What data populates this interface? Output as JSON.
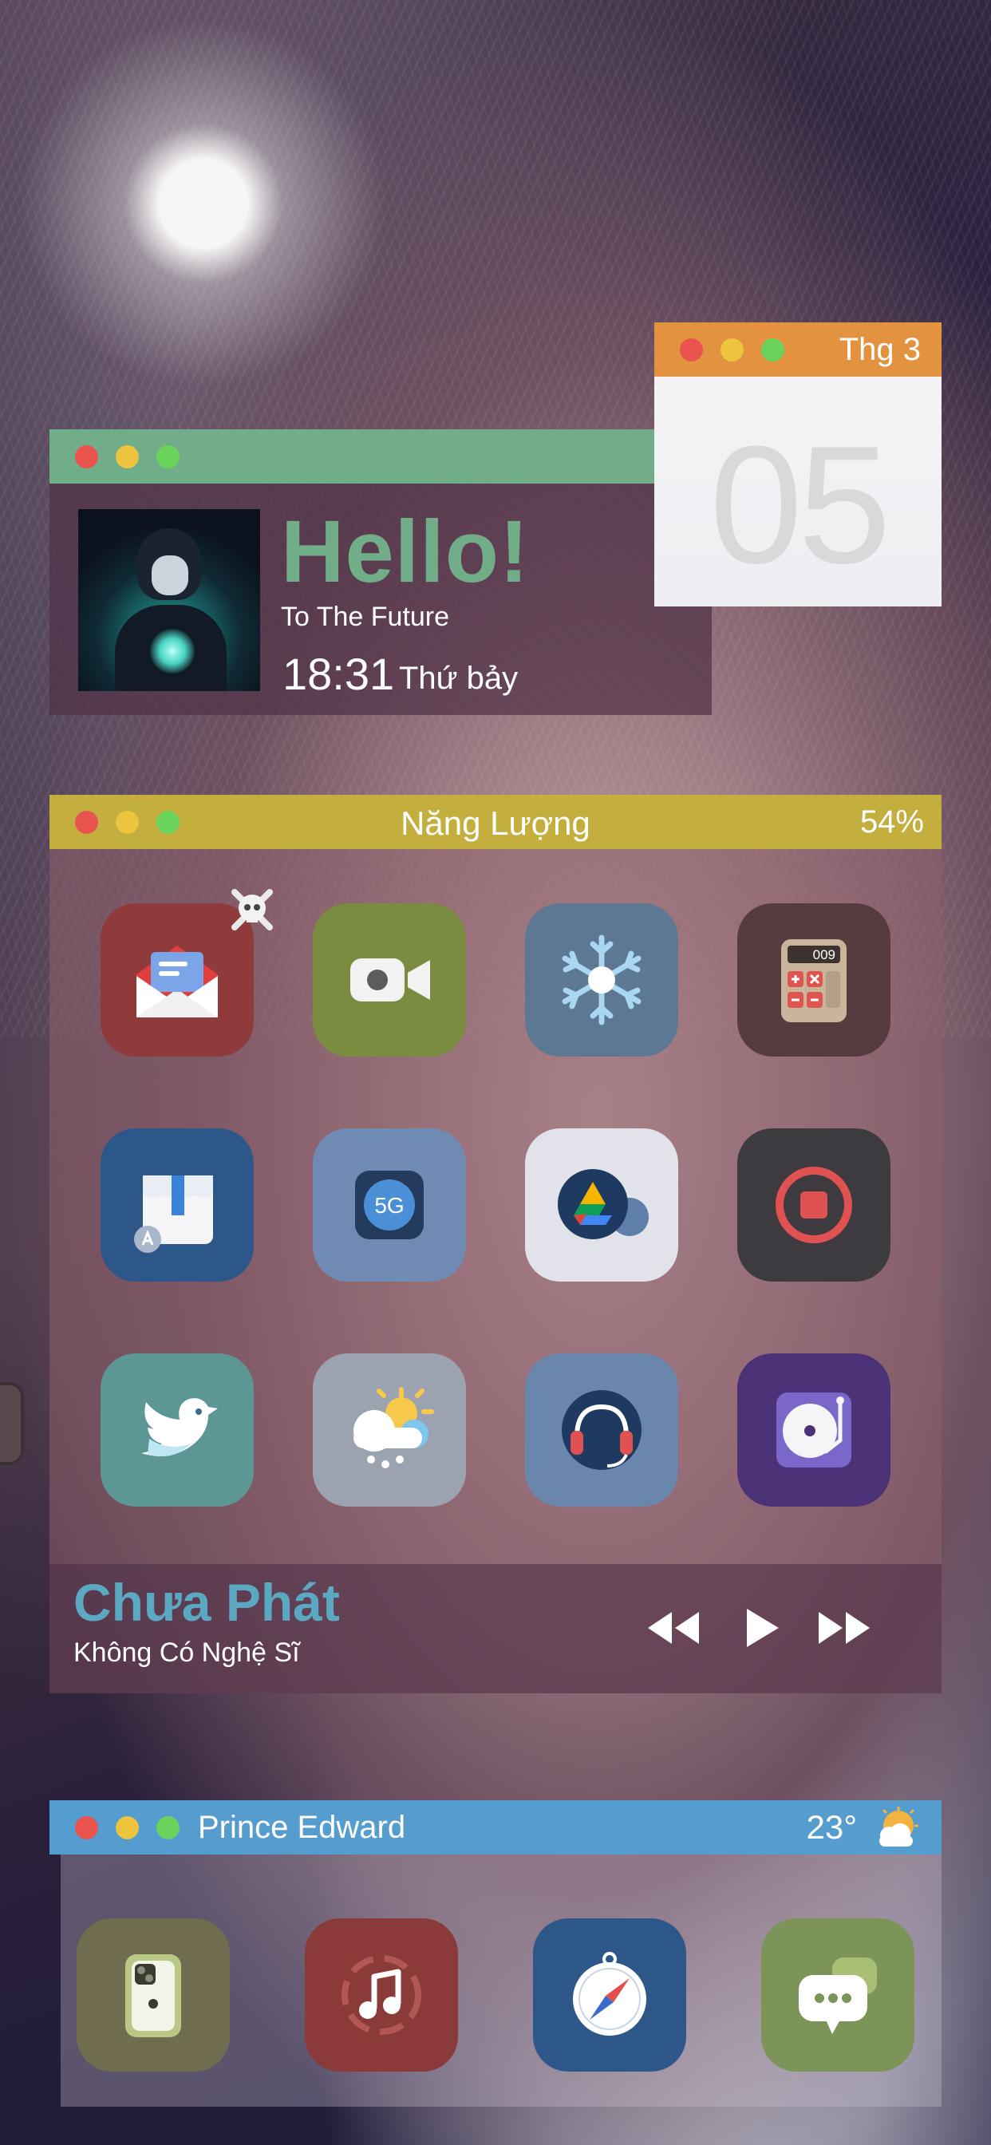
{
  "hello_widget": {
    "title": "Hello!",
    "subtitle": "To The Future",
    "time": "18:31",
    "day": "Thứ bảy"
  },
  "calendar_widget": {
    "month": "Thg 3",
    "day": "05"
  },
  "battery_widget": {
    "title": "Năng Lượng",
    "percent": "54%",
    "percent_value": 0.54,
    "apps": [
      {
        "name": "mail-app",
        "icon": "envelope-icon",
        "bg": "#8f3b3c"
      },
      {
        "name": "facetime-app",
        "icon": "video-camera-icon",
        "bg": "#7a8c40"
      },
      {
        "name": "snowflake-app",
        "icon": "snowflake-icon",
        "bg": "#5d7892"
      },
      {
        "name": "calculator-app",
        "icon": "calculator-icon",
        "bg": "#563b3f",
        "display": "009"
      },
      {
        "name": "app-store-app",
        "icon": "store-icon",
        "bg": "#2e5789"
      },
      {
        "name": "5g-app",
        "icon": "5g-icon",
        "bg": "#6f8bb3",
        "label": "5G"
      },
      {
        "name": "google-drive-app",
        "icon": "google-drive-icon",
        "bg": "#e2e3ea"
      },
      {
        "name": "screen-record-app",
        "icon": "record-icon",
        "bg": "#3d3a40"
      },
      {
        "name": "twitter-app",
        "icon": "bird-icon",
        "bg": "#5c9796"
      },
      {
        "name": "weather-app",
        "icon": "sun-cloud-rain-icon",
        "bg": "#9ba3b0"
      },
      {
        "name": "podcast-app",
        "icon": "headphones-icon",
        "bg": "#6a86ad"
      },
      {
        "name": "turntable-app",
        "icon": "turntable-icon",
        "bg": "#4b3175"
      }
    ]
  },
  "music": {
    "title": "Chưa Phát",
    "artist": "Không Có Nghệ Sĩ"
  },
  "dock_widget": {
    "location": "Prince Edward",
    "temperature": "23°",
    "weather_icon": "sun-cloud-icon",
    "apps": [
      {
        "name": "phone-app",
        "icon": "iphone-icon",
        "bg": "#6f6c50"
      },
      {
        "name": "music-app",
        "icon": "music-note-icon",
        "bg": "#8b3a3a"
      },
      {
        "name": "safari-app",
        "icon": "compass-icon",
        "bg": "#2e5789"
      },
      {
        "name": "messages-app",
        "icon": "chat-bubble-icon",
        "bg": "#7d9458"
      }
    ]
  },
  "colors": {
    "hello_accent": "#72ad8a",
    "calendar_accent": "#e3933f",
    "battery_accent": "#c4ae3e",
    "dock_accent": "#559ccf",
    "music_title": "#5aa8c2"
  }
}
